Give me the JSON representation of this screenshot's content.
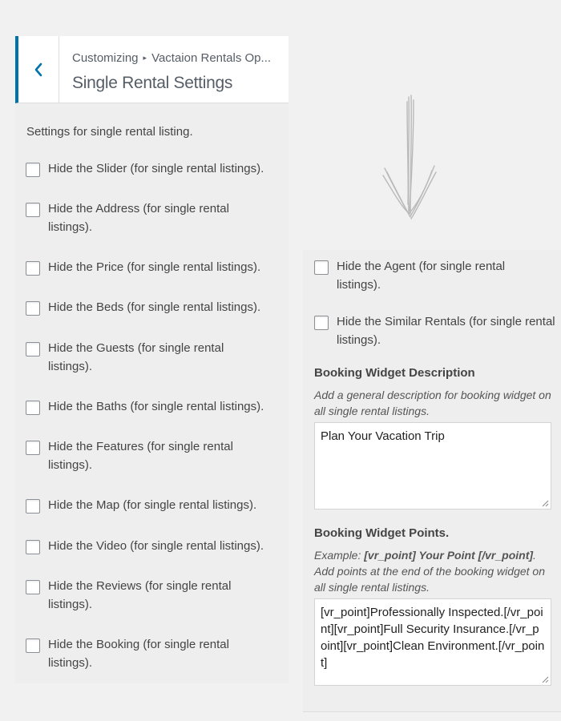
{
  "header": {
    "breadcrumb_root": "Customizing",
    "breadcrumb_section": "Vactaion Rentals Op...",
    "title": "Single Rental Settings"
  },
  "left_panel": {
    "description": "Settings for single rental listing.",
    "options": [
      {
        "label": "Hide the Slider (for single rental listings).",
        "checked": false
      },
      {
        "label": "Hide the Address (for single rental listings).",
        "checked": false
      },
      {
        "label": "Hide the Price (for single rental listings).",
        "checked": false
      },
      {
        "label": "Hide the Beds (for single rental listings).",
        "checked": false
      },
      {
        "label": "Hide the Guests (for single rental listings).",
        "checked": false
      },
      {
        "label": "Hide the Baths (for single rental listings).",
        "checked": false
      },
      {
        "label": "Hide the Features (for single rental listings).",
        "checked": false
      },
      {
        "label": "Hide the Map (for single rental listings).",
        "checked": false
      },
      {
        "label": "Hide the Video (for single rental listings).",
        "checked": false
      },
      {
        "label": "Hide the Reviews (for single rental listings).",
        "checked": false
      },
      {
        "label": "Hide the Booking (for single rental listings).",
        "checked": false
      }
    ]
  },
  "right_panel": {
    "options": [
      {
        "label": "Hide the Agent (for single rental listings).",
        "checked": false
      },
      {
        "label": "Hide the Similar Rentals (for single rental listings).",
        "checked": false
      }
    ],
    "booking_description": {
      "title": "Booking Widget Description",
      "help": "Add a general description for booking widget on all single rental listings.",
      "value": "Plan Your Vacation Trip"
    },
    "booking_points": {
      "title": "Booking Widget Points.",
      "help_prefix": "Example: ",
      "help_example": "[vr_point] Your Point [/vr_point]",
      "help_suffix": ". Add points at the end of the booking widget on all single rental listings.",
      "value": "[vr_point]Professionally Inspected.[/vr_point][vr_point]Full Security Insurance.[/vr_point][vr_point]Clean Environment.[/vr_point]"
    }
  },
  "colors": {
    "accent": "#0073aa",
    "panel_bg": "#eeeeee",
    "page_bg": "#f1f1f1"
  },
  "icons": {
    "back": "chevron-left-icon",
    "arrow": "hand-drawn-down-arrow-icon",
    "resize": "resize-handle-icon"
  }
}
